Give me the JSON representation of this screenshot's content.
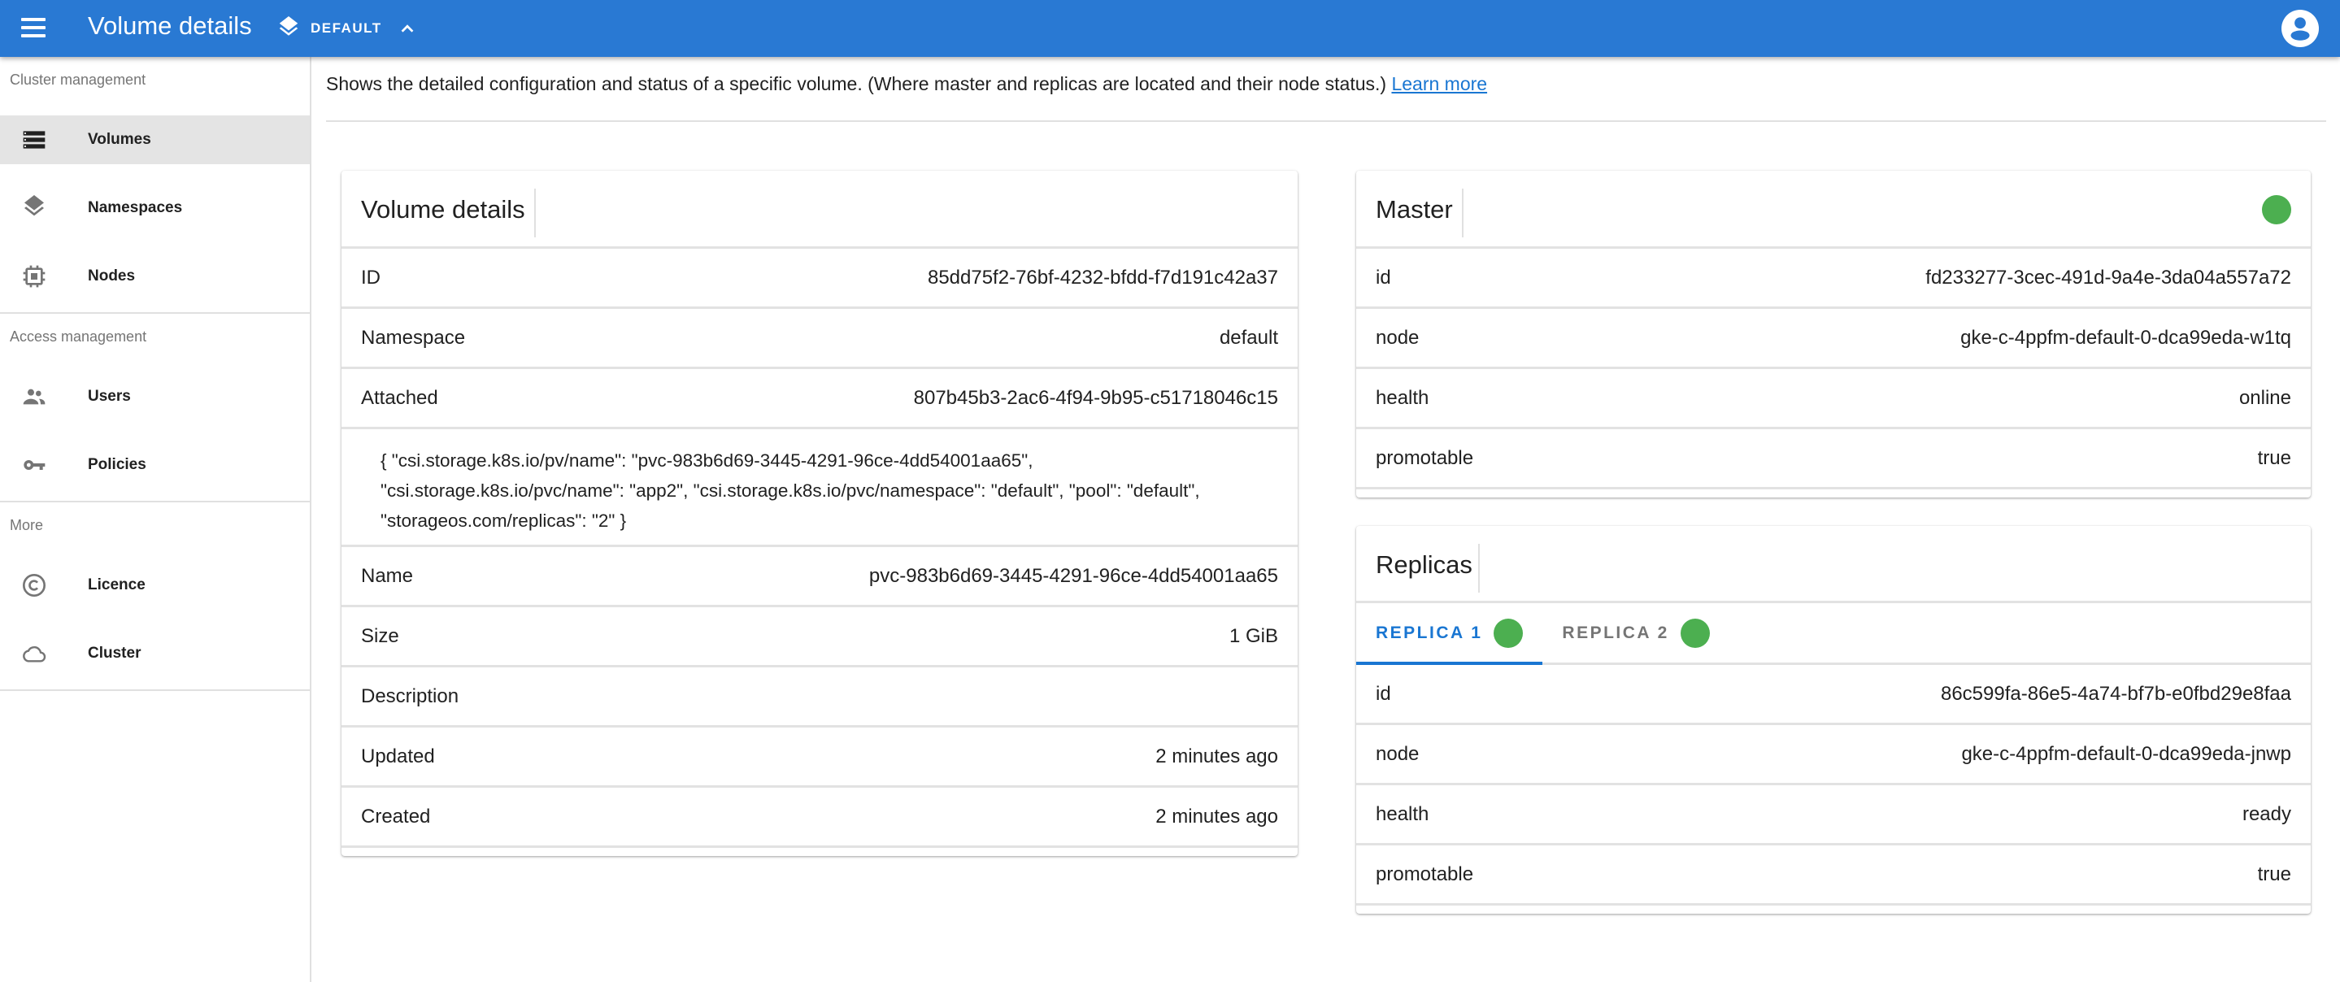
{
  "appbar": {
    "title": "Volume details",
    "namespace_selector": {
      "label": "DEFAULT",
      "icon": "layers-icon",
      "chevron": "chevron-up-icon"
    },
    "menu_icon": "menu-icon",
    "account_icon": "account-circle-icon",
    "color": "#2979d3"
  },
  "sidebar": {
    "sections": [
      {
        "title": "Cluster management",
        "items": [
          {
            "label": "Volumes",
            "icon": "storage-icon",
            "active": true
          },
          {
            "label": "Namespaces",
            "icon": "layers-icon",
            "active": false
          },
          {
            "label": "Nodes",
            "icon": "chip-icon",
            "active": false
          }
        ]
      },
      {
        "title": "Access management",
        "items": [
          {
            "label": "Users",
            "icon": "people-icon",
            "active": false
          },
          {
            "label": "Policies",
            "icon": "key-icon",
            "active": false
          }
        ]
      },
      {
        "title": "More",
        "items": [
          {
            "label": "Licence",
            "icon": "copyright-icon",
            "active": false
          },
          {
            "label": "Cluster",
            "icon": "cloud-icon",
            "active": false
          }
        ]
      }
    ]
  },
  "main": {
    "description": "Shows the detailed configuration and status of a specific volume. (Where master and replicas are located and their node status.)",
    "learn_more": "Learn more",
    "volume_card": {
      "title": "Volume details",
      "rows": [
        {
          "key": "ID",
          "value": "85dd75f2-76bf-4232-bfdd-f7d191c42a37"
        },
        {
          "key": "Namespace",
          "value": "default"
        },
        {
          "key": "Attached",
          "value": "807b45b3-2ac6-4f94-9b95-c51718046c15"
        }
      ],
      "labels": "{ \"csi.storage.k8s.io/pv/name\": \"pvc-983b6d69-3445-4291-96ce-4dd54001aa65\", \"csi.storage.k8s.io/pvc/name\": \"app2\", \"csi.storage.k8s.io/pvc/namespace\": \"default\", \"pool\": \"default\", \"storageos.com/replicas\": \"2\" }",
      "rows2": [
        {
          "key": "Name",
          "value": "pvc-983b6d69-3445-4291-96ce-4dd54001aa65"
        },
        {
          "key": "Size",
          "value": "1 GiB"
        },
        {
          "key": "Description",
          "value": ""
        },
        {
          "key": "Updated",
          "value": "2 minutes ago"
        },
        {
          "key": "Created",
          "value": "2 minutes ago"
        }
      ]
    },
    "master_card": {
      "title": "Master",
      "status": "healthy",
      "status_color": "#4caf50",
      "rows": [
        {
          "key": "id",
          "value": "fd233277-3cec-491d-9a4e-3da04a557a72"
        },
        {
          "key": "node",
          "value": "gke-c-4ppfm-default-0-dca99eda-w1tq"
        },
        {
          "key": "health",
          "value": "online"
        },
        {
          "key": "promotable",
          "value": "true"
        }
      ]
    },
    "replicas_card": {
      "title": "Replicas",
      "tabs": [
        {
          "label": "REPLICA 1",
          "active": true,
          "status_color": "#4caf50"
        },
        {
          "label": "REPLICA 2",
          "active": false,
          "status_color": "#4caf50"
        }
      ],
      "rows": [
        {
          "key": "id",
          "value": "86c599fa-86e5-4a74-bf7b-e0fbd29e8faa"
        },
        {
          "key": "node",
          "value": "gke-c-4ppfm-default-0-dca99eda-jnwp"
        },
        {
          "key": "health",
          "value": "ready"
        },
        {
          "key": "promotable",
          "value": "true"
        }
      ]
    }
  }
}
